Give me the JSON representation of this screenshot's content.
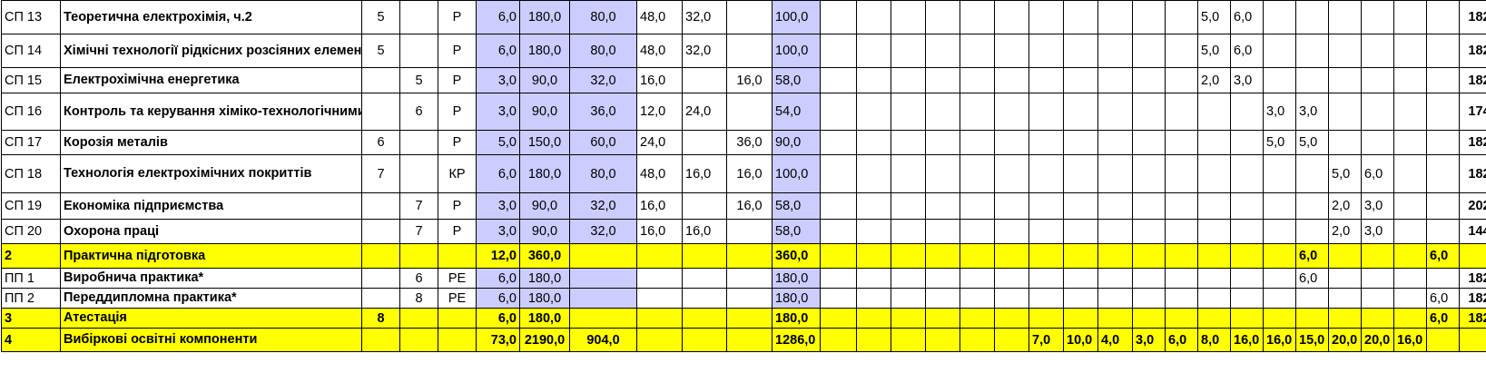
{
  "rows": [
    {
      "code": "СП 13",
      "name": "Теоретична електрохімія, ч.2",
      "exam": "5",
      "credit": "",
      "form": "Р",
      "ects": "6,0",
      "hours": "180,0",
      "aud": "80,0",
      "lec": "48,0",
      "lab": "32,0",
      "prac": "",
      "self": "100,0",
      "sem": [
        "",
        "",
        "",
        "",
        "",
        "",
        "",
        "",
        "",
        "",
        "",
        "5,0",
        "6,0",
        "",
        "",
        "",
        "",
        "",
        ""
      ],
      "last": "182",
      "h": 37
    },
    {
      "code": "СП 14",
      "name": "Хімічні технології рідкісних розсіяних елементів",
      "exam": "5",
      "credit": "",
      "form": "Р",
      "ects": "6,0",
      "hours": "180,0",
      "aud": "80,0",
      "lec": "48,0",
      "lab": "32,0",
      "prac": "",
      "self": "100,0",
      "sem": [
        "",
        "",
        "",
        "",
        "",
        "",
        "",
        "",
        "",
        "",
        "",
        "5,0",
        "6,0",
        "",
        "",
        "",
        "",
        "",
        ""
      ],
      "last": "182",
      "h": 37
    },
    {
      "code": "СП 15",
      "name": "Електрохімічна енергетика",
      "exam": "",
      "credit": "5",
      "form": "Р",
      "ects": "3,0",
      "hours": "90,0",
      "aud": "32,0",
      "lec": "16,0",
      "lab": "",
      "prac": "16,0",
      "self": "58,0",
      "sem": [
        "",
        "",
        "",
        "",
        "",
        "",
        "",
        "",
        "",
        "",
        "",
        "2,0",
        "3,0",
        "",
        "",
        "",
        "",
        "",
        ""
      ],
      "last": "182",
      "h": 28
    },
    {
      "code": "СП 16",
      "name": "Контроль та керування хіміко-технологічними процесами",
      "exam": "",
      "credit": "6",
      "form": "Р",
      "ects": "3,0",
      "hours": "90,0",
      "aud": "36,0",
      "lec": "12,0",
      "lab": "24,0",
      "prac": "",
      "self": "54,0",
      "sem": [
        "",
        "",
        "",
        "",
        "",
        "",
        "",
        "",
        "",
        "",
        "",
        "",
        "",
        "3,0",
        "3,0",
        "",
        "",
        "",
        ""
      ],
      "last": "174",
      "h": 41
    },
    {
      "code": "СП 17",
      "name": "Корозія металів",
      "exam": "6",
      "credit": "",
      "form": "Р",
      "ects": "5,0",
      "hours": "150,0",
      "aud": "60,0",
      "lec": "24,0",
      "lab": "",
      "prac": "36,0",
      "self": "90,0",
      "sem": [
        "",
        "",
        "",
        "",
        "",
        "",
        "",
        "",
        "",
        "",
        "",
        "",
        "",
        "5,0",
        "5,0",
        "",
        "",
        "",
        ""
      ],
      "last": "182",
      "h": 27
    },
    {
      "code": "СП 18",
      "name": "Технологія електрохімічних покриттів",
      "exam": "7",
      "credit": "",
      "form": "КР",
      "ects": "6,0",
      "hours": "180,0",
      "aud": "80,0",
      "lec": "48,0",
      "lab": "16,0",
      "prac": "16,0",
      "self": "100,0",
      "sem": [
        "",
        "",
        "",
        "",
        "",
        "",
        "",
        "",
        "",
        "",
        "",
        "",
        "",
        "",
        "",
        "5,0",
        "6,0",
        "",
        ""
      ],
      "last": "182",
      "h": 42
    },
    {
      "code": "СП 19",
      "name": "Економіка підприємства",
      "exam": "",
      "credit": "7",
      "form": "Р",
      "ects": "3,0",
      "hours": "90,0",
      "aud": "32,0",
      "lec": "16,0",
      "lab": "",
      "prac": "16,0",
      "self": "58,0",
      "sem": [
        "",
        "",
        "",
        "",
        "",
        "",
        "",
        "",
        "",
        "",
        "",
        "",
        "",
        "",
        "",
        "2,0",
        "3,0",
        "",
        ""
      ],
      "last": "202",
      "h": 29
    },
    {
      "code": "СП 20",
      "name": "Охорона праці",
      "exam": "",
      "credit": "7",
      "form": "Р",
      "ects": "3,0",
      "hours": "90,0",
      "aud": "32,0",
      "lec": "16,0",
      "lab": "16,0",
      "prac": "",
      "self": "58,0",
      "sem": [
        "",
        "",
        "",
        "",
        "",
        "",
        "",
        "",
        "",
        "",
        "",
        "",
        "",
        "",
        "",
        "2,0",
        "3,0",
        "",
        ""
      ],
      "last": "144",
      "h": 27
    },
    {
      "code": "2",
      "name": "Практична підготовка",
      "exam": "",
      "credit": "",
      "form": "",
      "ects": "12,0",
      "hours": "360,0",
      "aud": "",
      "lec": "",
      "lab": "",
      "prac": "",
      "self": "360,0",
      "sem": [
        "",
        "",
        "",
        "",
        "",
        "",
        "",
        "",
        "",
        "",
        "",
        "",
        "",
        "",
        "6,0",
        "",
        "",
        "",
        "6,0"
      ],
      "last": "",
      "h": 27,
      "yellow": true
    },
    {
      "code": "ПП 1",
      "name": "Виробнича практика*",
      "exam": "",
      "credit": "6",
      "form": "РЕ",
      "ects": "6,0",
      "hours": "180,0",
      "aud": "",
      "lec": "",
      "lab": "",
      "prac": "",
      "self": "180,0",
      "sem": [
        "",
        "",
        "",
        "",
        "",
        "",
        "",
        "",
        "",
        "",
        "",
        "",
        "",
        "",
        "6,0",
        "",
        "",
        "",
        ""
      ],
      "last": "182",
      "h": 22
    },
    {
      "code": "ПП 2",
      "name": "Переддипломна практика*",
      "exam": "",
      "credit": "8",
      "form": "РЕ",
      "ects": "6,0",
      "hours": "180,0",
      "aud": "",
      "lec": "",
      "lab": "",
      "prac": "",
      "self": "180,0",
      "sem": [
        "",
        "",
        "",
        "",
        "",
        "",
        "",
        "",
        "",
        "",
        "",
        "",
        "",
        "",
        "",
        "",
        "",
        "",
        "6,0"
      ],
      "last": "182",
      "h": 22
    },
    {
      "code": "3",
      "name": "Атестація",
      "exam": "8",
      "credit": "",
      "form": "",
      "ects": "6,0",
      "hours": "180,0",
      "aud": "",
      "lec": "",
      "lab": "",
      "prac": "",
      "self": "180,0",
      "sem": [
        "",
        "",
        "",
        "",
        "",
        "",
        "",
        "",
        "",
        "",
        "",
        "",
        "",
        "",
        "",
        "",
        "",
        "",
        "6,0"
      ],
      "last": "182",
      "h": 22,
      "yellow": true
    },
    {
      "code": "4",
      "name": "Вибіркові освітні компоненти",
      "exam": "",
      "credit": "",
      "form": "",
      "ects": "73,0",
      "hours": "2190,0",
      "aud": "904,0",
      "lec": "",
      "lab": "",
      "prac": "",
      "self": "1286,0",
      "sem": [
        "",
        "",
        "",
        "",
        "",
        "",
        "7,0",
        "10,0",
        "4,0",
        "3,0",
        "6,0",
        "8,0",
        "16,0",
        "16,0",
        "15,0",
        "20,0",
        "20,0",
        "16,0",
        ""
      ],
      "last": "",
      "h": 26,
      "yellow": true
    }
  ]
}
